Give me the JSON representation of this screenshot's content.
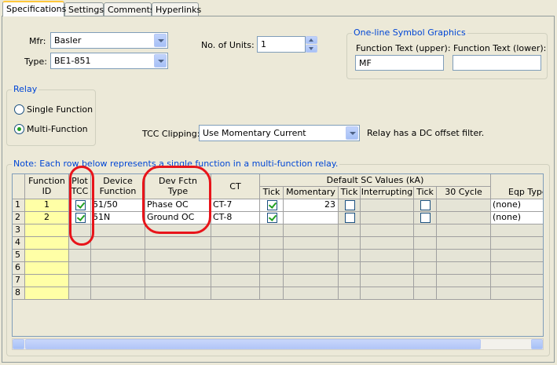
{
  "tabs": [
    "Specifications",
    "Settings",
    "Comments",
    "Hyperlinks"
  ],
  "mfr": {
    "label": "Mfr:",
    "value": "Basler"
  },
  "type": {
    "label": "Type:",
    "value": "BE1-851"
  },
  "units": {
    "label": "No. of Units:",
    "value": "1"
  },
  "symbol": {
    "title": "One-line Symbol Graphics",
    "upper_label": "Function Text (upper):",
    "upper_value": "MF",
    "lower_label": "Function Text (lower):",
    "lower_value": ""
  },
  "relay": {
    "title": "Relay",
    "single": "Single Function",
    "multi": "Multi-Function",
    "selected": "multi"
  },
  "tcc": {
    "label": "TCC Clipping:",
    "value": "Use Momentary Current",
    "note": "Relay has a DC offset filter."
  },
  "grid": {
    "title": "Note: Each row below represents a single function in a multi-function relay.",
    "group_header": "Default SC Values (kA)",
    "headers": {
      "function_id": [
        "Function",
        "ID"
      ],
      "plot_tcc": [
        "Plot",
        "TCC"
      ],
      "device_function": [
        "Device",
        "Function"
      ],
      "dev_fctn_type": [
        "Dev Fctn",
        "Type"
      ],
      "ct": "CT",
      "tick": "Tick",
      "momentary": "Momentary",
      "interrupting": "Interrupting",
      "cycle30": "30 Cycle",
      "eqp_type": "Eqp Type"
    },
    "row_numbers": [
      "1",
      "2",
      "3",
      "4",
      "5",
      "6",
      "7",
      "8"
    ],
    "rows": [
      {
        "id": "1",
        "plot": true,
        "device": "51/50",
        "type": "Phase OC",
        "ct": "CT-7",
        "tick1": true,
        "momentary": "23",
        "tick2": false,
        "interrupting": "",
        "tick3": false,
        "cycle30": "",
        "eqp": "(none)"
      },
      {
        "id": "2",
        "plot": true,
        "device": "51N",
        "type": "Ground OC",
        "ct": "CT-8",
        "tick1": true,
        "momentary": "",
        "tick2": false,
        "interrupting": "",
        "tick3": false,
        "cycle30": "",
        "eqp": "(none)"
      }
    ]
  },
  "annotations": {
    "color": "#E8141A"
  }
}
